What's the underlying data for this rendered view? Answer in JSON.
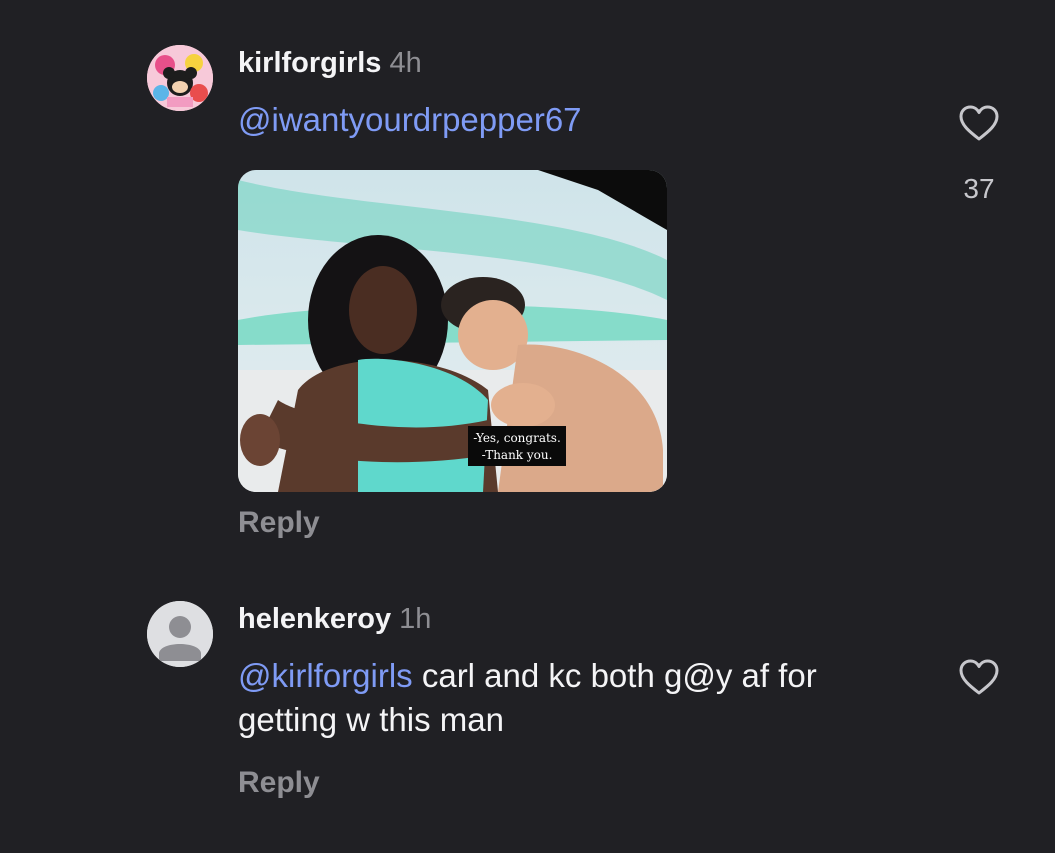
{
  "comments": [
    {
      "username": "kirlforgirls",
      "time": "4h",
      "mention": "@iwantyourdrpepper67",
      "text": "",
      "media": {
        "subtitle_line1": "-Yes, congrats.",
        "subtitle_line2": "-Thank you."
      },
      "like_count": "37",
      "reply_label": "Reply",
      "icons": {
        "avatar": "cartoon-avatar",
        "like": "heart-icon"
      }
    },
    {
      "username": "helenkeroy",
      "time": "1h",
      "mention": "@kirlforgirls",
      "text": " carl and kc both g@y af for getting w this man",
      "reply_label": "Reply",
      "icons": {
        "avatar": "default-user-avatar",
        "like": "heart-icon"
      }
    }
  ],
  "colors": {
    "background": "#202024",
    "mention": "#7f9bf5",
    "muted": "#8e8e93"
  }
}
